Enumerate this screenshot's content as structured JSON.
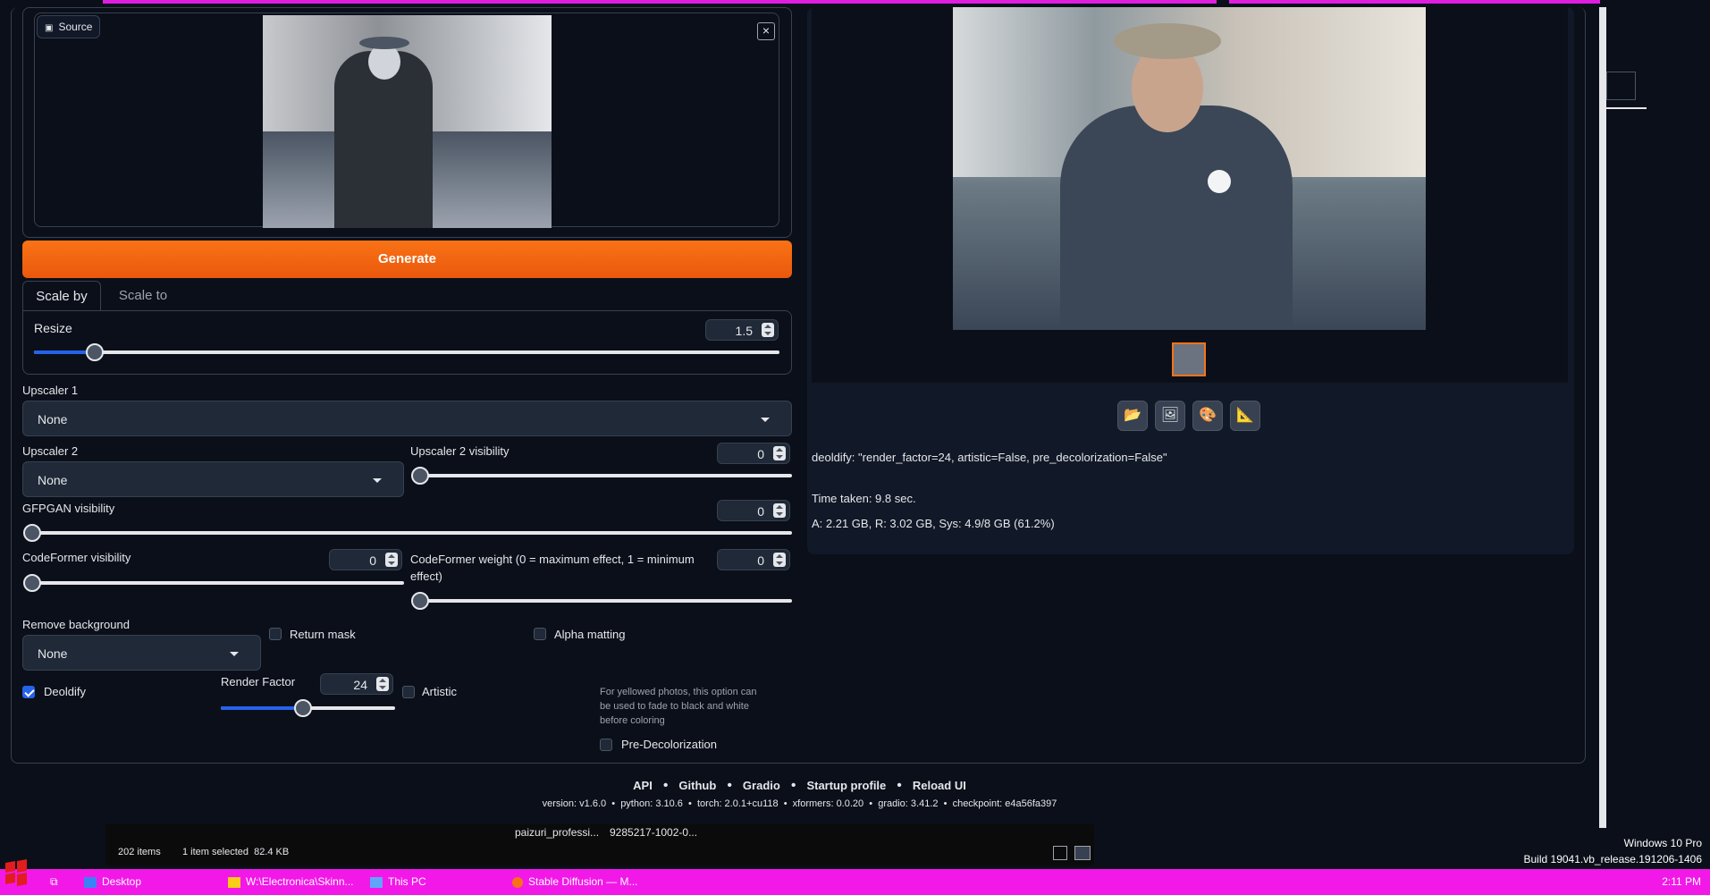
{
  "source": {
    "label": "Source",
    "close_icon": "×"
  },
  "generate": {
    "label": "Generate"
  },
  "tabs": [
    "Scale by",
    "Scale to"
  ],
  "resize": {
    "label": "Resize",
    "value": "1.5",
    "fraction": 0.08
  },
  "upscaler1": {
    "label": "Upscaler 1",
    "value": "None"
  },
  "upscaler2": {
    "label": "Upscaler 2",
    "value": "None"
  },
  "upscaler2_visibility": {
    "label": "Upscaler 2 visibility",
    "value": "0"
  },
  "gfpgan": {
    "label": "GFPGAN visibility",
    "value": "0"
  },
  "codeformer_visibility": {
    "label": "CodeFormer visibility",
    "value": "0"
  },
  "codeformer_weight": {
    "label": "CodeFormer weight (0 = maximum effect, 1 = minimum effect)",
    "value": "0"
  },
  "remove_background": {
    "label": "Remove background",
    "value": "None"
  },
  "return_mask": {
    "label": "Return mask",
    "checked": false
  },
  "alpha_matting": {
    "label": "Alpha matting",
    "checked": false
  },
  "deoldify": {
    "label": "Deoldify",
    "checked": true
  },
  "render_factor": {
    "label": "Render Factor",
    "value": "24",
    "fraction": 0.48
  },
  "artistic": {
    "label": "Artistic",
    "checked": false
  },
  "pre_decolor_hint": [
    "For yellowed photos, this option can",
    "be used to fade to black and white",
    "before coloring"
  ],
  "pre_decolorization": {
    "label": "Pre-Decolorization",
    "checked": false
  },
  "output": {
    "info": "deoldify: \"render_factor=24, artistic=False, pre_decolorization=False\"",
    "time_taken": "Time taken: 9.8 sec.",
    "memory": "A: 2.21 GB, R: 3.02 GB, Sys: 4.9/8 GB (61.2%)",
    "buttons": [
      "folder-icon",
      "image-icon",
      "palette-icon",
      "ruler-icon"
    ]
  },
  "footer": {
    "links": [
      "API",
      "Github",
      "Gradio",
      "Startup profile",
      "Reload UI"
    ],
    "version_line": "version: v1.6.0  •  python: 3.10.6  •  torch: 2.0.1+cu118  •  xformers: 0.0.20  •  gradio: 3.41.2  •  checkpoint: e4a56fa397"
  },
  "explorer": {
    "items": "202 items",
    "selected": "1 item selected  82.4 KB",
    "file1": "paizuri_professi...",
    "file2": "9285217-1002-0..."
  },
  "windows": {
    "edition": "Windows 10 Pro",
    "build": "Build 19041.vb_release.191206-1406",
    "time": "2:11 PM"
  },
  "taskbar": [
    "Desktop",
    "W:\\Electronica\\Skinn...",
    "This PC",
    "Stable Diffusion — M..."
  ],
  "colors": {
    "accent": "#f97316",
    "taskbar": "#f218e8",
    "bg": "#0b0f19",
    "blue": "#2563eb"
  }
}
